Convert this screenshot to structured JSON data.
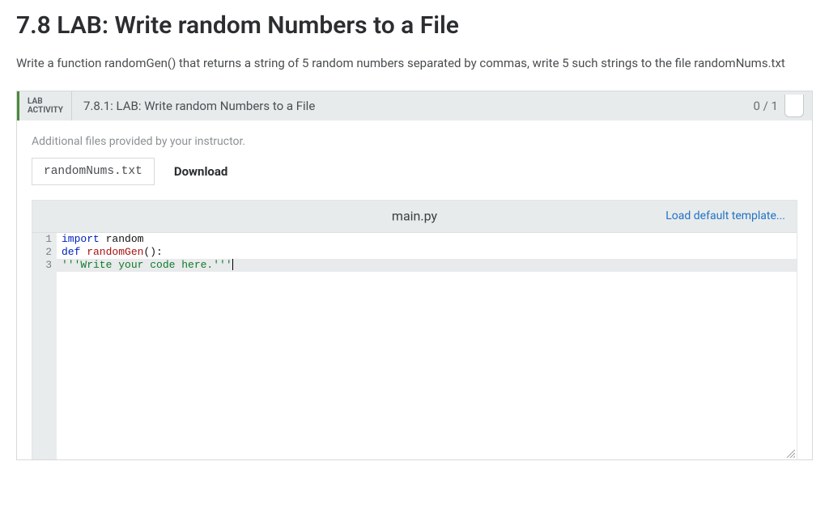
{
  "page": {
    "title": "7.8 LAB: Write random Numbers to a File",
    "description": "Write a function randomGen() that returns a string of 5 random numbers separated by commas, write 5 such strings to the file randomNums.txt"
  },
  "lab_header": {
    "badge_line1": "LAB",
    "badge_line2": "ACTIVITY",
    "title": "7.8.1: LAB: Write random Numbers to a File",
    "score": "0 / 1"
  },
  "additional_files": {
    "label": "Additional files provided by your instructor.",
    "file_name": "randomNums.txt",
    "download_label": "Download"
  },
  "editor": {
    "filename": "main.py",
    "load_template_label": "Load default template...",
    "lines": {
      "n1": "1",
      "n2": "2",
      "n3": "3",
      "l1_kw": "import",
      "l1_mod": " random",
      "l2_kw": "def",
      "l2_name": " randomGen",
      "l2_paren": "():",
      "l3_str": "'''Write your code here.'''"
    }
  }
}
